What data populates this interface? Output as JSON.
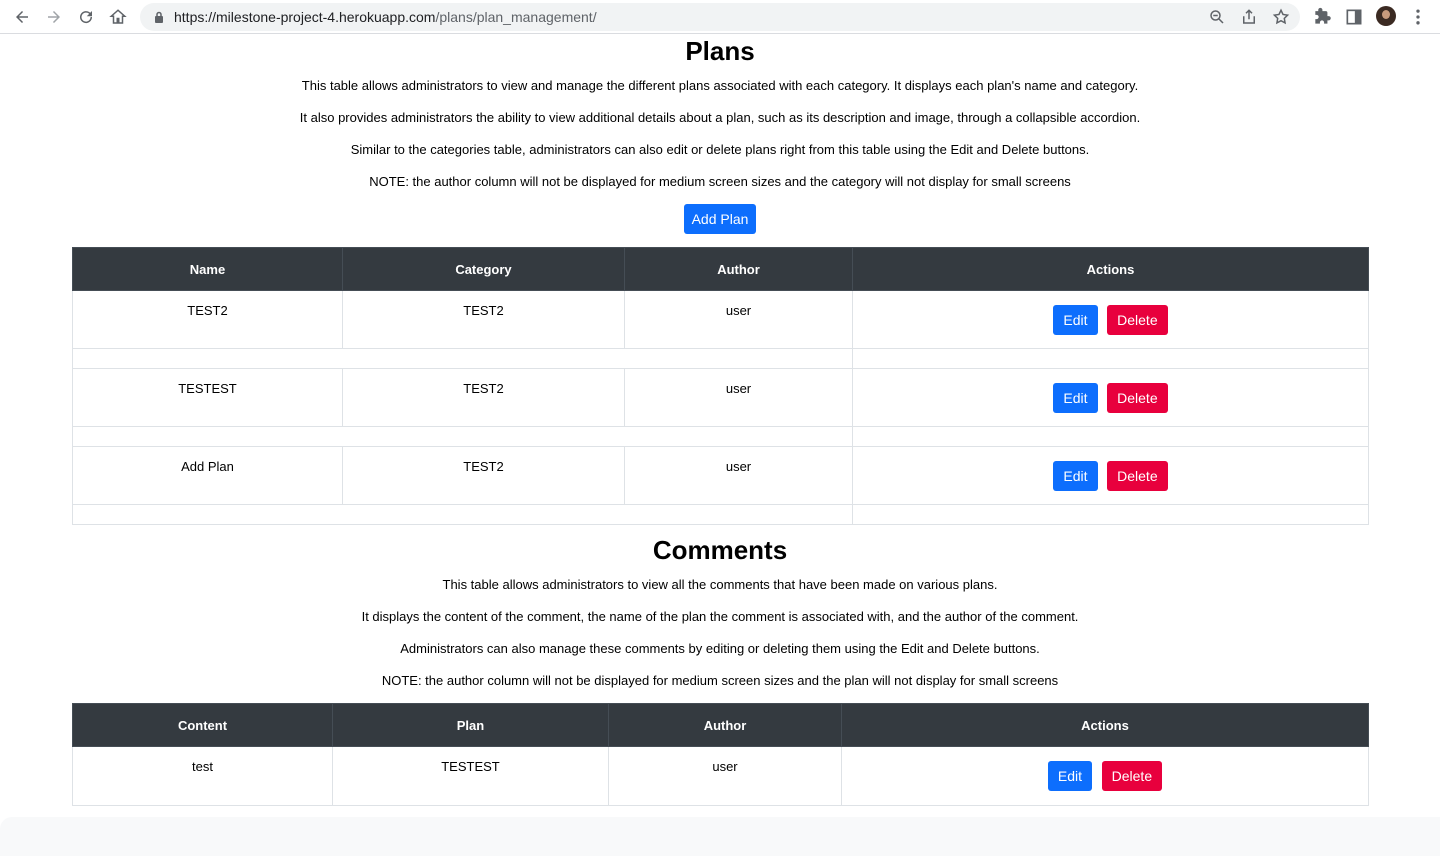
{
  "browser": {
    "url_domain": "https://milestone-project-4.herokuapp.com",
    "url_path": "/plans/plan_management/"
  },
  "plans": {
    "title": "Plans",
    "paragraphs": [
      "This table allows administrators to view and manage the different plans associated with each category. It displays each plan's name and category.",
      "It also provides administrators the ability to view additional details about a plan, such as its description and image, through a collapsible accordion.",
      "Similar to the categories table, administrators can also edit or delete plans right from this table using the Edit and Delete buttons.",
      "NOTE: the author column will not be displayed for medium screen sizes and the category will not display for small screens"
    ],
    "add_button": "Add Plan",
    "columns": [
      "Name",
      "Category",
      "Author",
      "Actions"
    ],
    "rows": [
      {
        "name": "TEST2",
        "category": "TEST2",
        "author": "user"
      },
      {
        "name": "TESTEST",
        "category": "TEST2",
        "author": "user"
      },
      {
        "name": "Add Plan",
        "category": "TEST2",
        "author": "user"
      }
    ]
  },
  "comments": {
    "title": "Comments",
    "paragraphs": [
      "This table allows administrators to view all the comments that have been made on various plans.",
      "It displays the content of the comment, the name of the plan the comment is associated with, and the author of the comment.",
      "Administrators can also manage these comments by editing or deleting them using the Edit and Delete buttons.",
      "NOTE: the author column will not be displayed for medium screen sizes and the plan will not display for small screens"
    ],
    "columns": [
      "Content",
      "Plan",
      "Author",
      "Actions"
    ],
    "rows": [
      {
        "content": "test",
        "plan": "TESTEST",
        "author": "user"
      }
    ]
  },
  "actions": {
    "edit": "Edit",
    "delete": "Delete"
  },
  "colors": {
    "primary": "#0d6efd",
    "danger": "#e8003d",
    "table_header": "#343a40"
  }
}
